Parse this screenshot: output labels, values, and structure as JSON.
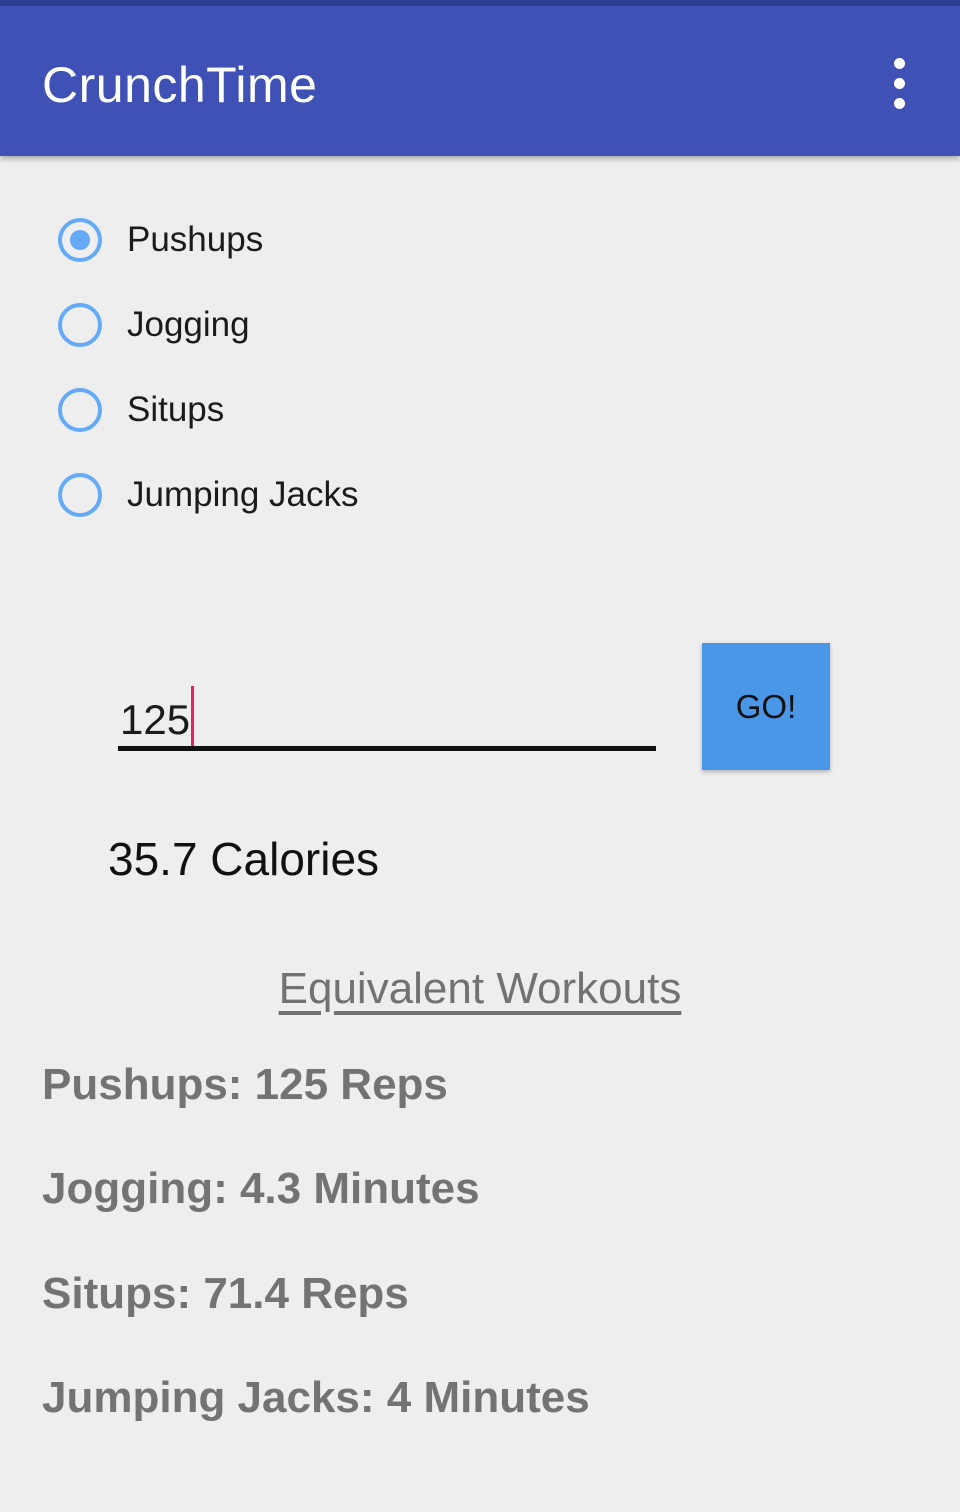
{
  "app_bar": {
    "title": "CrunchTime",
    "overflow_icon": "more-vert-icon",
    "color": "#3f51b5"
  },
  "exercises": [
    {
      "label": "Pushups",
      "selected": true
    },
    {
      "label": "Jogging",
      "selected": false
    },
    {
      "label": "Situps",
      "selected": false
    },
    {
      "label": "Jumping Jacks",
      "selected": false
    }
  ],
  "input": {
    "value": "125"
  },
  "go_button": {
    "label": "GO!",
    "color": "#4a97e8"
  },
  "calories_text": "35.7 Calories",
  "equivalent": {
    "heading": "Equivalent Workouts",
    "results": [
      "Pushups: 125 Reps",
      "Jogging: 4.3 Minutes",
      "Situps: 71.4 Reps",
      "Jumping Jacks: 4 Minutes"
    ]
  },
  "accent_color": "#64aaf6",
  "caret_color": "#e91e63"
}
